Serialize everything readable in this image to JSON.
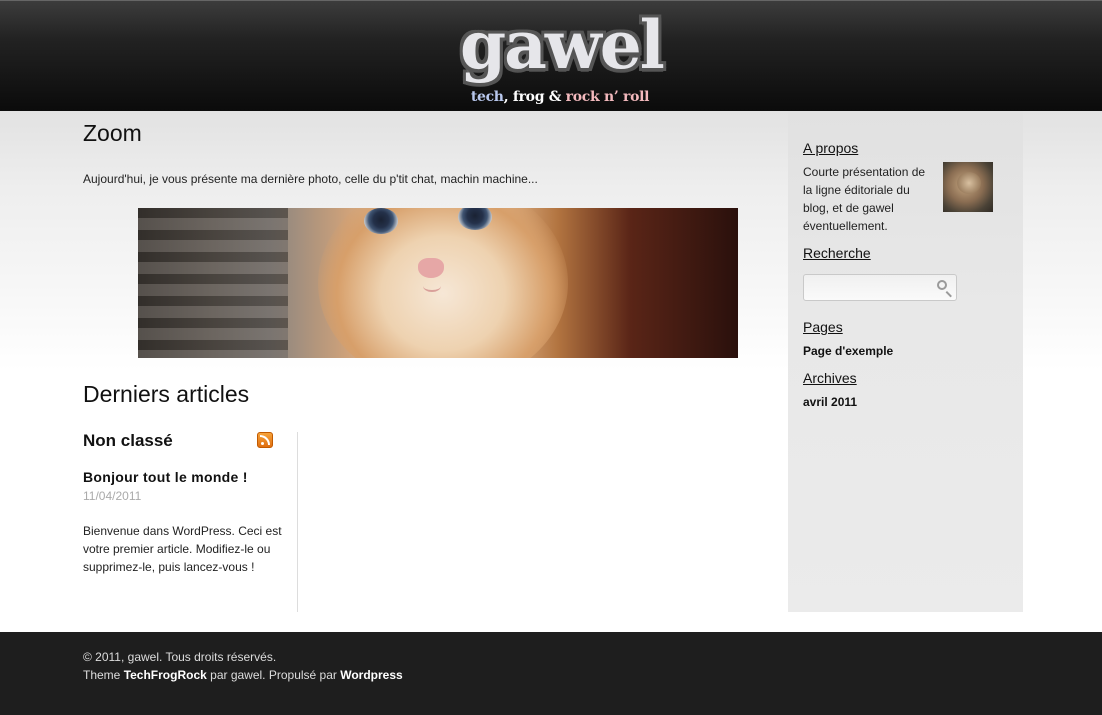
{
  "header": {
    "logo_text": "gawel",
    "tagline": {
      "part1": "tech",
      "sep1": ",",
      "part2": " frog &",
      "part3": " rock n’ roll"
    }
  },
  "post": {
    "title": "Zoom",
    "intro": "Aujourd'hui, je vous présente ma dernière photo, celle du p'tit chat, machin machine..."
  },
  "latest": {
    "heading": "Derniers articles",
    "category": "Non classé",
    "article": {
      "title": "Bonjour tout le monde !",
      "date": "11/04/2011",
      "excerpt": "Bienvenue dans WordPress. Ceci est votre premier article. Modifiez-le ou supprimez-le, puis lancez-vous !"
    }
  },
  "sidebar": {
    "about": {
      "title": "A propos",
      "text": "Courte présentation de la ligne éditoriale du blog, et de gawel éventuellement."
    },
    "search": {
      "title": "Recherche",
      "value": "",
      "placeholder": ""
    },
    "pages": {
      "title": "Pages",
      "items": [
        "Page d'exemple"
      ]
    },
    "archives": {
      "title": "Archives",
      "items": [
        "avril 2011"
      ]
    }
  },
  "footer": {
    "copyright": "© 2011, gawel. Tous droits réservés.",
    "theme_prefix": "Theme ",
    "theme_name": "TechFrogRock",
    "theme_mid": " par gawel. Propulsé par ",
    "powered_by": "Wordpress"
  },
  "colors": {
    "header_bg": "#111111",
    "footer_bg": "#1e1e1e",
    "sidebar_bg": "#e6e6e6",
    "tag_tech": "#b9c8ee",
    "tag_rock": "#f3b9bd",
    "rss": "#f08a24"
  },
  "icons": [
    "rss-icon",
    "search-icon"
  ]
}
